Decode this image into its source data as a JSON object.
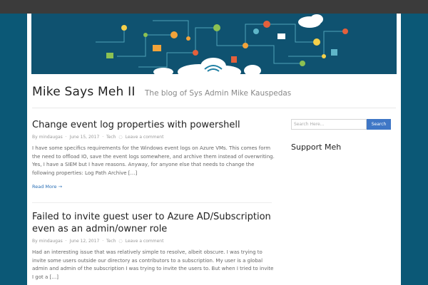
{
  "site": {
    "title": "Mike Says Meh II",
    "tagline": "The blog of Sys Admin Mike Kauspedas"
  },
  "banner": {
    "accent": "#0f5270",
    "icons": [
      "cloud-icon",
      "gear-icon",
      "chart-icon",
      "mail-icon",
      "user-icon",
      "wifi-icon",
      "lock-icon"
    ]
  },
  "posts": [
    {
      "title": "Change event log properties with powershell",
      "meta": {
        "author": "By mindaugas",
        "date": "June 15, 2017",
        "category": "Tech",
        "comments": "Leave a comment"
      },
      "excerpt": "I have some specifics requirements for the Windows event logs on Azure VMs. This comes form the need to offload IO, save the event logs somewhere, and archive them instead of overwriting. Yes, I have a SIEM but I have reasons. Anyway, for anyone else that needs to change the following properties: Log Path Archive […]",
      "read_more": "Read More →"
    },
    {
      "title": "Failed to invite guest user to Azure AD/Subscription even as an admin/owner role",
      "meta": {
        "author": "By mindaugas",
        "date": "June 12, 2017",
        "category": "Tech",
        "comments": "Leave a comment"
      },
      "excerpt": "Had an interesting issue that was relatively simple to resolve, albeit obscure. I was trying to invite some users outside our directory as contributors to a subscription. My user is a global admin and admin of the subscription I was trying to invite the users to. But when I tried to invite I got a […]"
    }
  ],
  "sidebar": {
    "search_placeholder": "Search Here...",
    "search_button": "Search",
    "widget_title": "Support Meh"
  },
  "colors": {
    "page_bg": "#0b5876",
    "topbar": "#3b3b3b",
    "link": "#2a6fb5",
    "button": "#3f77c6"
  }
}
